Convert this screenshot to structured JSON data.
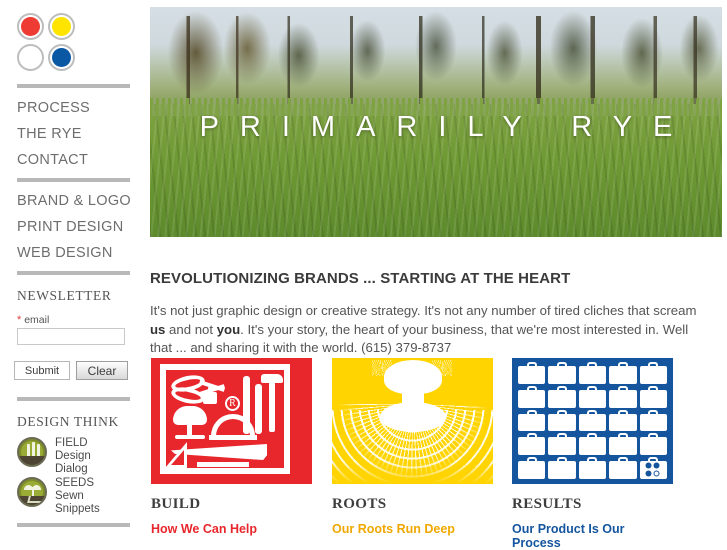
{
  "logo": {
    "name": "primarily-rye-logo",
    "dots": [
      {
        "name": "red-dot",
        "color": "#ee3b33"
      },
      {
        "name": "yellow-dot",
        "color": "#ffe400"
      },
      {
        "name": "white-dot",
        "color": "#ffffff"
      },
      {
        "name": "blue-dot",
        "color": "#0a57a4"
      }
    ]
  },
  "sidebar": {
    "primary_nav": [
      {
        "label": "PROCESS"
      },
      {
        "label": "THE RYE"
      },
      {
        "label": "CONTACT"
      }
    ],
    "secondary_nav": [
      {
        "label": "BRAND & LOGO"
      },
      {
        "label": "PRINT DESIGN"
      },
      {
        "label": "WEB DESIGN"
      }
    ],
    "newsletter": {
      "heading": "NEWSLETTER",
      "required_mark": "*",
      "field_label": "email",
      "email_value": "",
      "email_placeholder": "",
      "submit_label": "Submit",
      "clear_label": "Clear"
    },
    "design_think": {
      "heading": "DESIGN THINK",
      "items": [
        {
          "title": "FIELD",
          "subtitle": "Design Dialog",
          "icon": "field-badge-icon"
        },
        {
          "title": "SEEDS",
          "subtitle": "Sewn Snippets",
          "icon": "seeds-badge-icon"
        }
      ]
    }
  },
  "hero": {
    "title": "PRIMARILY RYE",
    "image_alt": "grass-field-with-trees-photo"
  },
  "main": {
    "lead_heading": "REVOLUTIONIZING BRANDS ... STARTING AT THE HEART",
    "lead_body_1": "It's not just graphic design or creative strategy. It's not any number of tired cliches that scream ",
    "lead_body_bold_1": "us",
    "lead_body_2": " and not ",
    "lead_body_bold_2": "you",
    "lead_body_3": ". It's your story, the heart of your business, that we're most interested in. Well that ... and sharing it with the world. (615) 379-8737",
    "cards": [
      {
        "title": "BUILD",
        "link": "How We Can Help",
        "link_color": "#e8272d",
        "tile_color": "#e8272d",
        "icon": "tools-collage-icon"
      },
      {
        "title": "ROOTS",
        "link": "Our Roots Run Deep",
        "link_color": "#f0a800",
        "tile_color": "#ffd400",
        "icon": "tree-roots-icon"
      },
      {
        "title": "RESULTS",
        "link": "Our Product Is Our Process",
        "link_color": "#14559e",
        "tile_color": "#14559e",
        "icon": "briefcase-grid-icon"
      }
    ]
  }
}
